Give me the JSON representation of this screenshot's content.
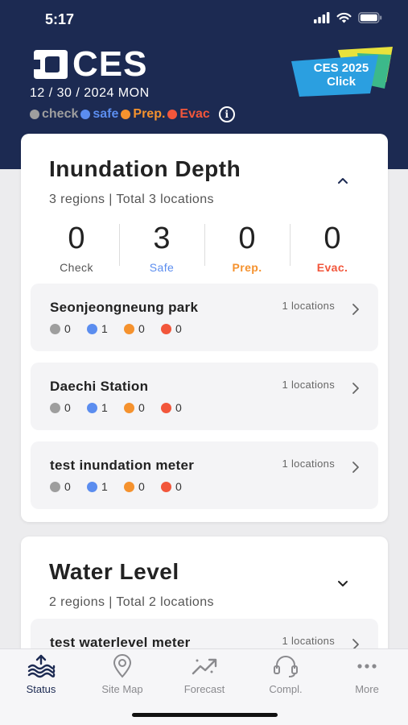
{
  "status_bar": {
    "time": "5:17"
  },
  "header": {
    "logo_text": "CES",
    "date": "12 / 30 / 2024  MON",
    "legend": [
      {
        "label": "check",
        "color": "#9e9e9e"
      },
      {
        "label": "safe",
        "color": "#5b8def"
      },
      {
        "label": "Prep.",
        "color": "#f5922e"
      },
      {
        "label": "Evac",
        "color": "#f2563b"
      }
    ],
    "info_glyph": "i",
    "promo": {
      "line1": "CES 2025",
      "line2": "Click"
    }
  },
  "inundation": {
    "title": "Inundation Depth",
    "subtitle": "3 regions | Total 3 locations",
    "counts": [
      {
        "value": "0",
        "label": "Check",
        "color": "#555555"
      },
      {
        "value": "3",
        "label": "Safe",
        "color": "#5b8def"
      },
      {
        "value": "0",
        "label": "Prep.",
        "color": "#f5922e"
      },
      {
        "value": "0",
        "label": "Evac.",
        "color": "#f2563b"
      }
    ],
    "rows": [
      {
        "name": "Seonjeongneung park",
        "locations": "1 locations",
        "stats": [
          "0",
          "1",
          "0",
          "0"
        ]
      },
      {
        "name": "Daechi Station",
        "locations": "1 locations",
        "stats": [
          "0",
          "1",
          "0",
          "0"
        ]
      },
      {
        "name": "test inundation meter",
        "locations": "1 locations",
        "stats": [
          "0",
          "1",
          "0",
          "0"
        ]
      }
    ]
  },
  "water_level": {
    "title": "Water Level",
    "subtitle": "2 regions | Total 2 locations",
    "rows": [
      {
        "name": "test waterlevel meter",
        "locations": "1 locations"
      }
    ]
  },
  "tabbar": {
    "tabs": [
      {
        "label": "Status",
        "icon": "waves-icon",
        "active": true
      },
      {
        "label": "Site Map",
        "icon": "map-pin-icon",
        "active": false
      },
      {
        "label": "Forecast",
        "icon": "trend-icon",
        "active": false
      },
      {
        "label": "Compl.",
        "icon": "headset-icon",
        "active": false
      },
      {
        "label": "More",
        "icon": "more-icon",
        "active": false
      }
    ]
  },
  "colors": {
    "navy": "#1c2a52",
    "check": "#9e9e9e",
    "safe": "#5b8def",
    "prep": "#f5922e",
    "evac": "#f2563b"
  }
}
